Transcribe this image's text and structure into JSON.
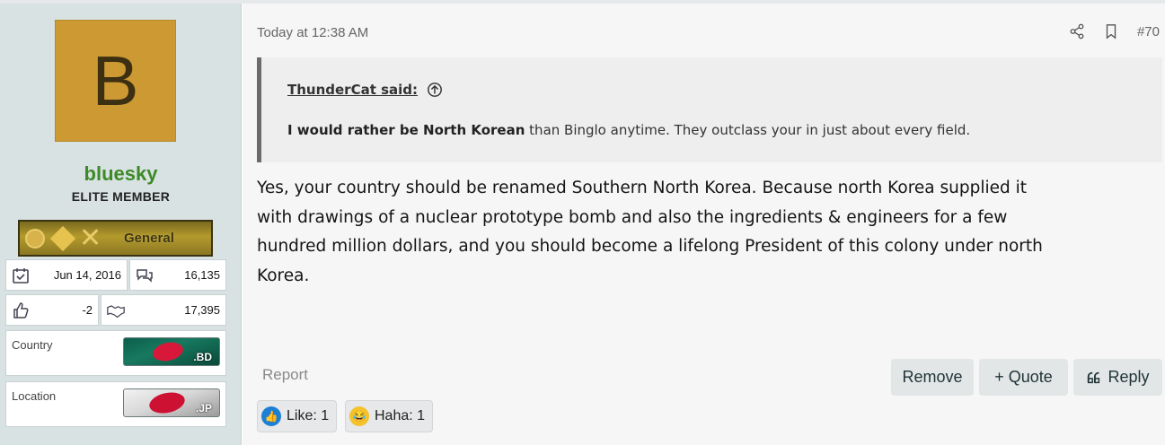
{
  "user": {
    "avatar_letter": "B",
    "avatar_color": "#cc9933",
    "username": "bluesky",
    "title": "ELITE MEMBER",
    "rank_label": "General",
    "joined": "Jun 14, 2016",
    "messages": "16,135",
    "reaction_score": "-2",
    "points": "17,395",
    "country_label": "Country",
    "country_flag": ".BD",
    "location_label": "Location",
    "location_flag": ".JP"
  },
  "post": {
    "date": "Today at 12:38 AM",
    "number": "#70",
    "quote": {
      "author": "ThunderCat said:",
      "bold_text": "I would rather be North Korean",
      "rest_text": " than Binglo anytime. They outclass your in just about every field."
    },
    "lines": [
      "Yes, your country should be renamed Southern North Korea. Because north Korea supplied it",
      "with drawings of a nuclear prototype bomb and also the ingredients & engineers for a few",
      "hundred million dollars, and you should become a lifelong President of this colony under north",
      "Korea."
    ]
  },
  "actions": {
    "report": "Report",
    "remove": "Remove",
    "quote": "+ Quote",
    "reply": "Reply"
  },
  "reactions": [
    {
      "icon": "like-emoji-icon",
      "label": "Like: 1"
    },
    {
      "icon": "haha-emoji-icon",
      "label": "Haha: 1"
    }
  ],
  "colors": {
    "username": "#3d8a26",
    "sidebar": "#d8e2e3",
    "button": "#e2e6e7"
  }
}
